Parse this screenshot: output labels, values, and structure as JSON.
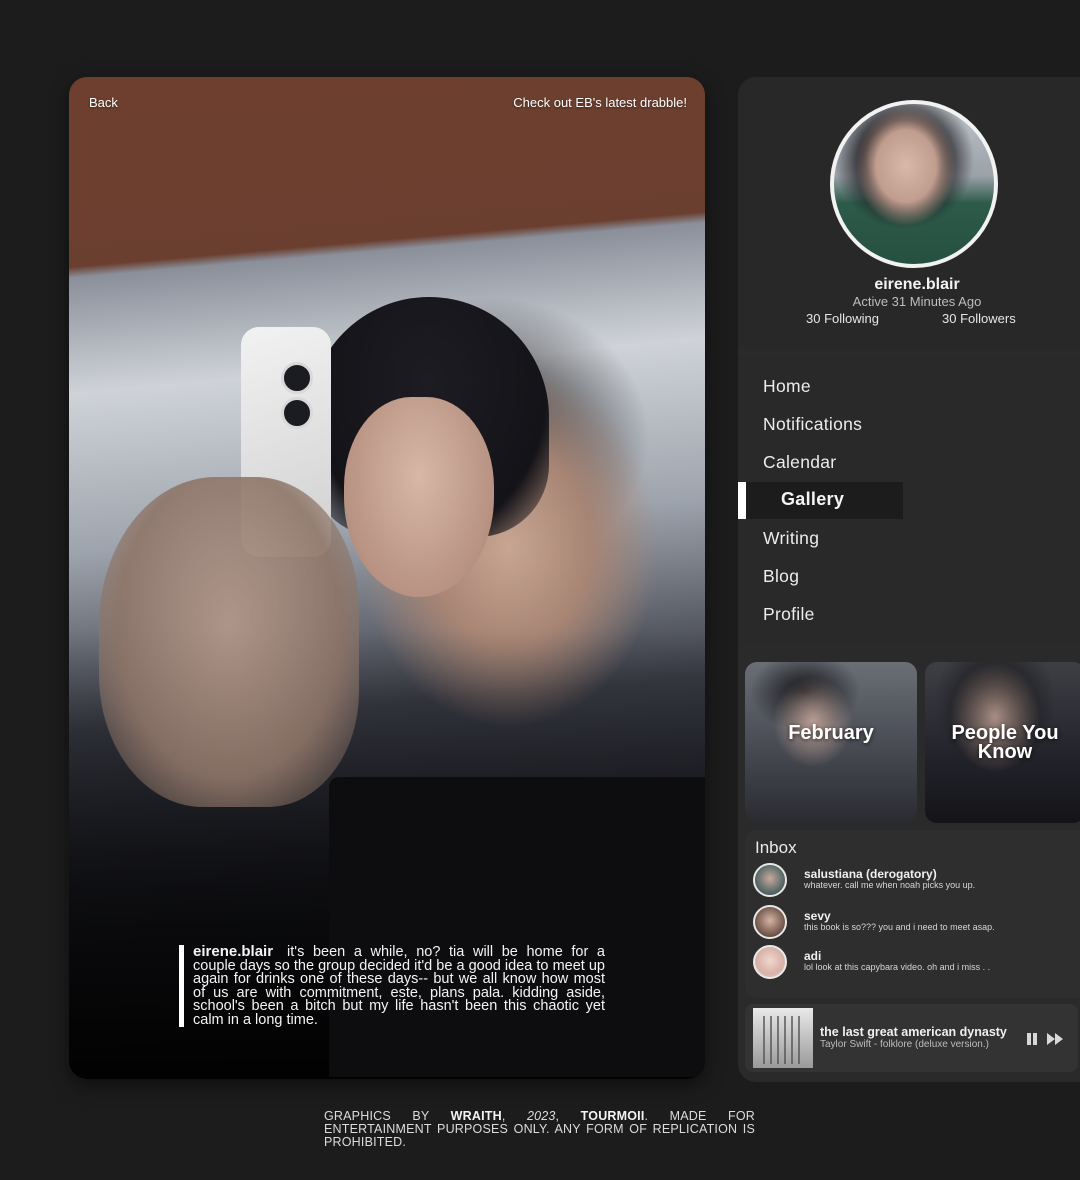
{
  "photo": {
    "back_label": "Back",
    "cta_label": "Check out EB's latest drabble!",
    "caption_user": "eirene.blair",
    "caption_text": "it's been a while, no? tia will be home for a couple days so the group decided it'd be a good idea to meet up again for drinks one of these days-- but we all know how most of us are with commitment, este, plans pala. kidding aside, school's been a bitch but my life hasn't been this chaotic yet calm in a long time."
  },
  "profile": {
    "username": "eirene.blair",
    "active": "Active 31 Minutes Ago",
    "following": "30 Following",
    "followers": "30 Followers"
  },
  "nav": {
    "home": "Home",
    "notifications": "Notifications",
    "calendar": "Calendar",
    "gallery": "Gallery",
    "writing": "Writing",
    "blog": "Blog",
    "profile": "Profile",
    "active_item": "Gallery"
  },
  "tiles": {
    "february": "February",
    "people_you_know": "People You Know"
  },
  "inbox": {
    "title": "Inbox",
    "messages": [
      {
        "name": "salustiana (derogatory)",
        "text": "whatever. call me when noah picks you up."
      },
      {
        "name": "sevy",
        "text": "this book is so??? you and i need to meet asap."
      },
      {
        "name": "adi",
        "text": "lol look at this capybara video. oh and i miss . ."
      }
    ]
  },
  "player": {
    "title": "the last great american dynasty",
    "artist": "Taylor Swift - folklore (deluxe version.)",
    "state": "playing"
  },
  "footer": {
    "p1": "GRAPHICS BY ",
    "author": "WRAITH",
    "sep1": ", ",
    "year": "2023",
    "sep2": ", ",
    "brand": "TOURMOII",
    "p2": ". MADE FOR ENTERTAINMENT PURPOSES ONLY. ANY FORM OF REPLICATION IS PROHIBITED."
  },
  "colors": {
    "background": "#1c1c1c",
    "panel": "#2a2a2a",
    "accent": "#ffffff"
  }
}
